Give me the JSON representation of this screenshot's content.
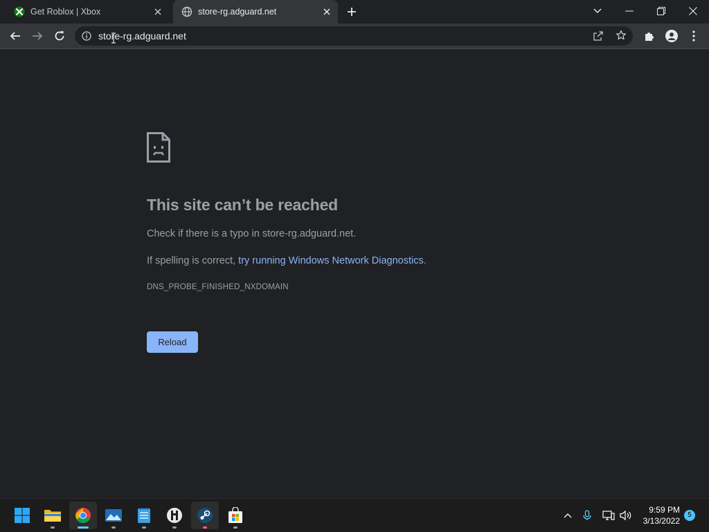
{
  "browser": {
    "tabs": [
      {
        "title": "Get Roblox | Xbox",
        "favicon": "xbox-icon",
        "active": false
      },
      {
        "title": "store-rg.adguard.net",
        "favicon": "globe-icon",
        "active": true
      }
    ],
    "address": {
      "url": "store-rg.adguard.net"
    }
  },
  "error_page": {
    "heading": "This site can’t be reached",
    "typo_line": "Check if there is a typo in store-rg.adguard.net.",
    "spelling_prefix": "If spelling is correct, ",
    "diagnostics_link": "try running Windows Network Diagnostics",
    "spelling_suffix": ".",
    "error_code": "DNS_PROBE_FINISHED_NXDOMAIN",
    "reload_label": "Reload"
  },
  "taskbar": {
    "apps": [
      "start-icon",
      "file-explorer-icon",
      "chrome-icon",
      "photos-icon",
      "notepad-icon",
      "app-icon",
      "steam-icon",
      "store-icon"
    ],
    "clock": {
      "time": "9:59 PM",
      "date": "3/13/2022"
    },
    "notification_count": "5"
  },
  "colors": {
    "page_bg": "#202124",
    "toolbar_bg": "#35363a",
    "link": "#8ab4f8",
    "button_bg": "#8ab4f8",
    "text_muted": "#9aa0a6"
  }
}
